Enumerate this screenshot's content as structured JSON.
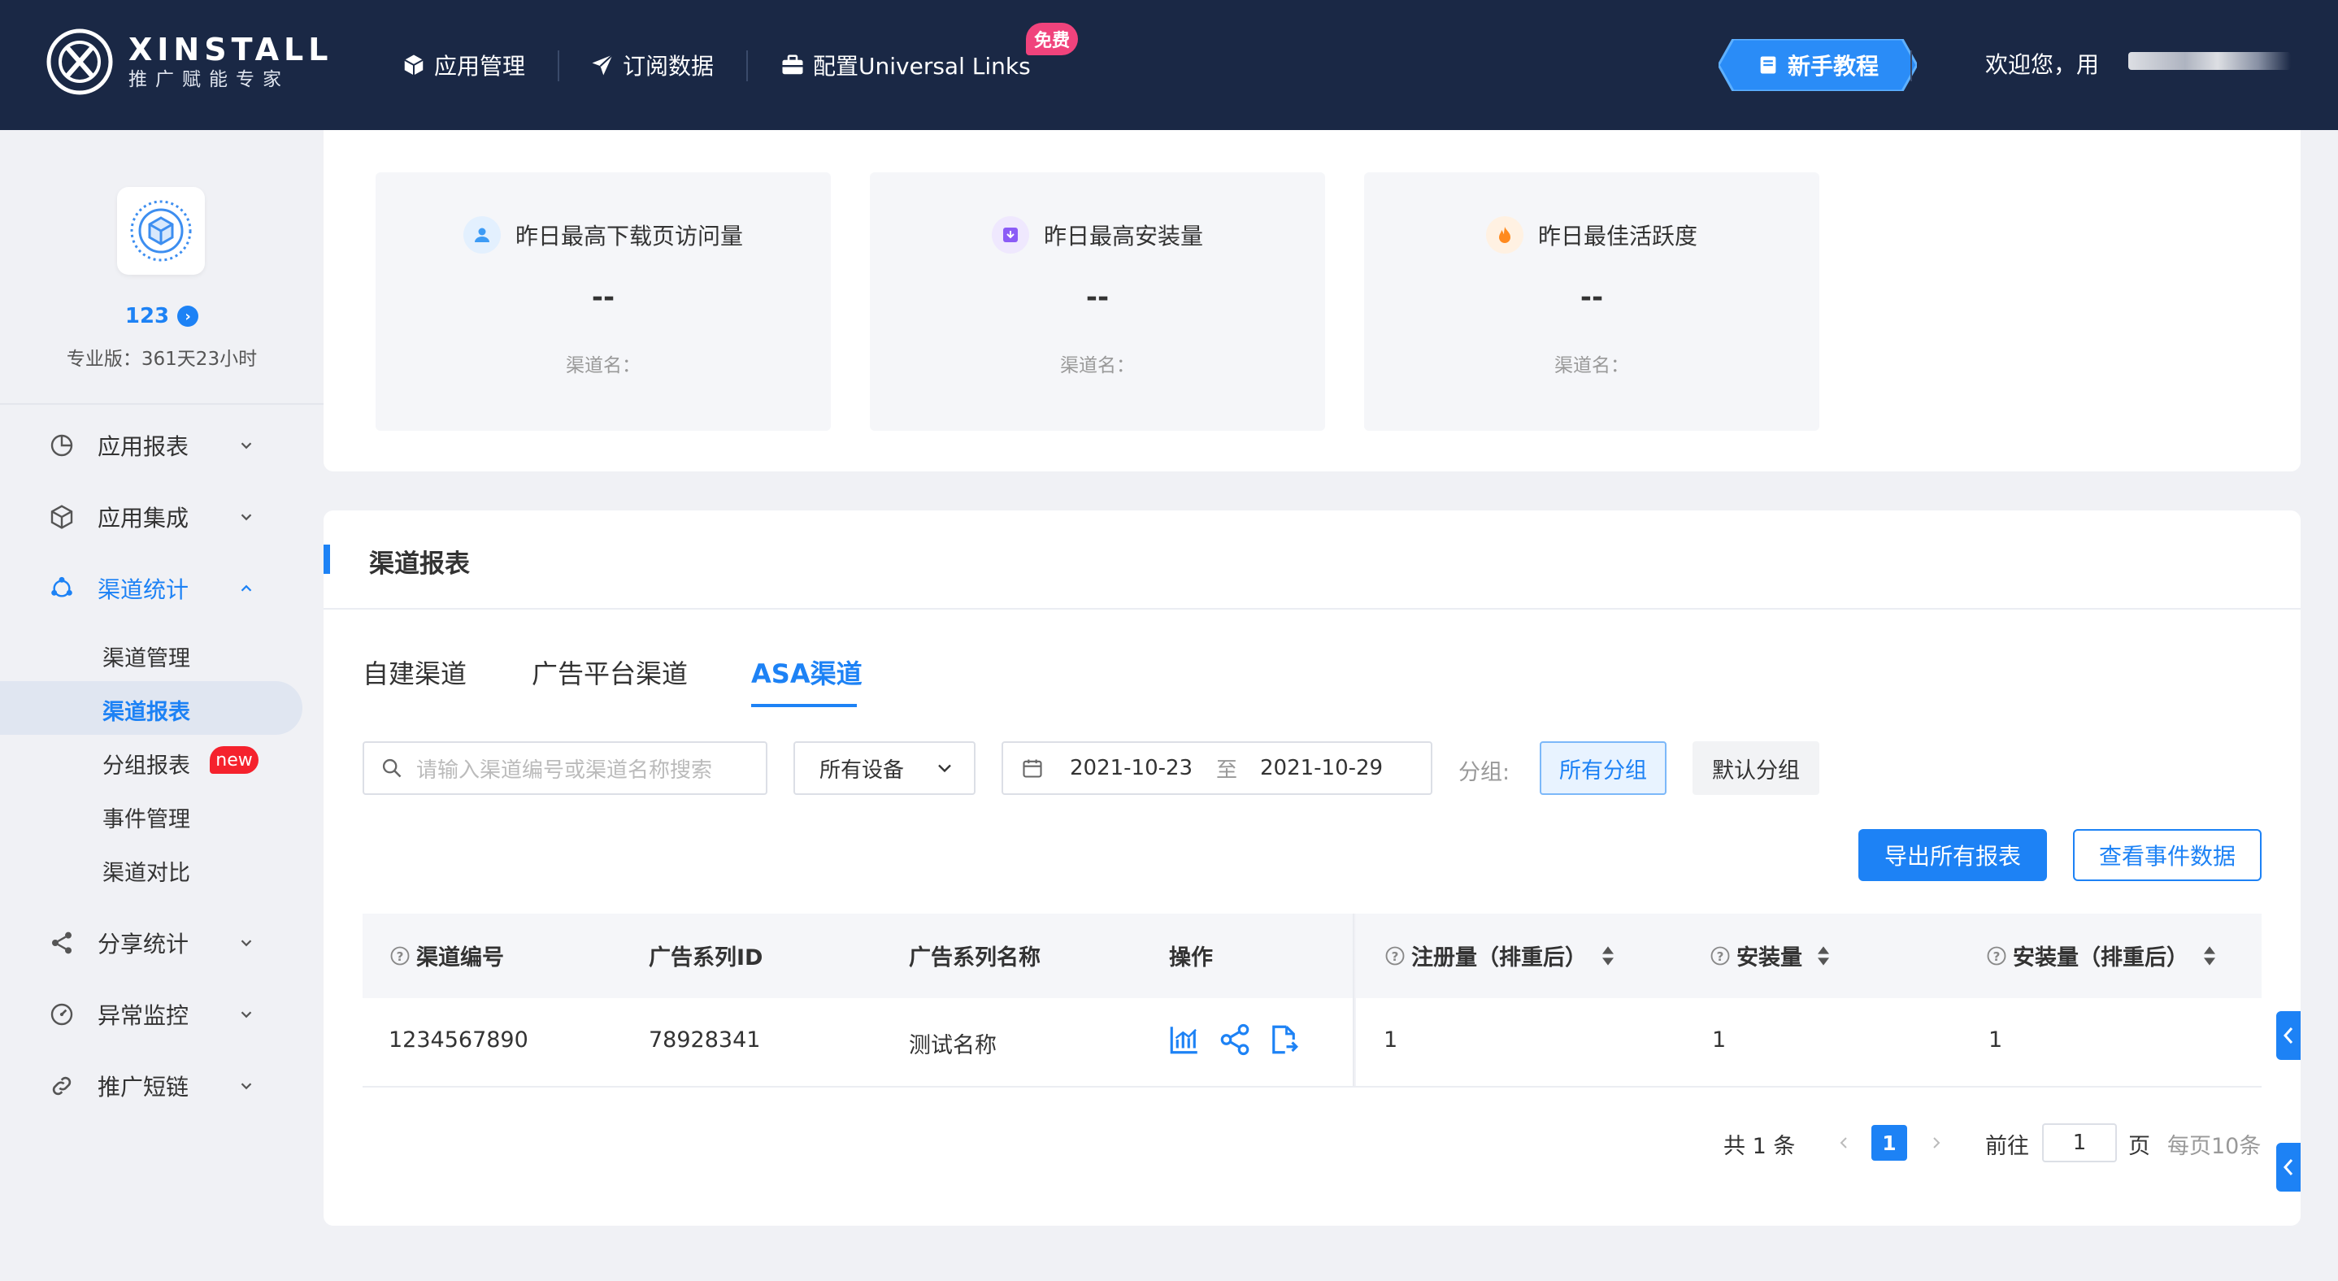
{
  "brand": {
    "name": "XINSTALL",
    "tagline": "推广赋能专家"
  },
  "nav": {
    "items": [
      {
        "label": "应用管理",
        "icon": "cube-icon"
      },
      {
        "label": "订阅数据",
        "icon": "paper-plane-icon"
      },
      {
        "label": "配置Universal Links",
        "icon": "briefcase-icon"
      }
    ],
    "free_badge": "免费",
    "tutorial_label": "新手教程",
    "welcome": "欢迎您，用"
  },
  "sidebar": {
    "app_name": "123",
    "plan": "专业版：361天23小时",
    "menu": [
      {
        "label": "应用报表",
        "icon": "pie-chart-icon"
      },
      {
        "label": "应用集成",
        "icon": "box-icon"
      },
      {
        "label": "渠道统计",
        "icon": "channel-icon",
        "expanded": true
      },
      {
        "label": "分享统计",
        "icon": "share-icon"
      },
      {
        "label": "异常监控",
        "icon": "gauge-icon"
      },
      {
        "label": "推广短链",
        "icon": "link-icon"
      }
    ],
    "sub_items": [
      "渠道管理",
      "渠道报表",
      "分组报表",
      "事件管理",
      "渠道对比"
    ],
    "active_sub": "渠道报表",
    "new_badge": "new"
  },
  "stats": [
    {
      "title": "昨日最高下载页访问量",
      "value": "--",
      "channel": "渠道名：",
      "icon": "user-icon",
      "color": "#3d9bf5"
    },
    {
      "title": "昨日最高安装量",
      "value": "--",
      "channel": "渠道名：",
      "icon": "install-icon",
      "color": "#8b5cf6"
    },
    {
      "title": "昨日最佳活跃度",
      "value": "--",
      "channel": "渠道名：",
      "icon": "fire-icon",
      "color": "#ff8a1f"
    }
  ],
  "report": {
    "title": "渠道报表",
    "tabs": [
      "自建渠道",
      "广告平台渠道",
      "ASA渠道"
    ],
    "active_tab": "ASA渠道",
    "filters": {
      "search_placeholder": "请输入渠道编号或渠道名称搜索",
      "device": "所有设备",
      "date_start": "2021-10-23",
      "date_sep": "至",
      "date_end": "2021-10-29",
      "group_label": "分组:",
      "group_options": [
        "所有分组",
        "默认分组"
      ],
      "group_selected": "所有分组"
    },
    "buttons": {
      "export": "导出所有报表",
      "events": "查看事件数据"
    },
    "columns": [
      "渠道编号",
      "广告系列ID",
      "广告系列名称",
      "操作",
      "注册量（排重后）",
      "安装量",
      "安装量（排重后）"
    ],
    "rows": [
      {
        "channel_id": "1234567890",
        "campaign_id": "78928341",
        "campaign_name": "测试名称",
        "registrations": "1",
        "installs": "1",
        "installs_dedup": "1"
      }
    ],
    "pagination": {
      "total": "共 1 条",
      "page": "1",
      "goto": "前往",
      "goto_value": "1",
      "page_unit": "页",
      "per_page": "每页10条"
    }
  },
  "colors": {
    "nav_bg": "#1a2845",
    "accent": "#1d82f5",
    "page_bg": "#f0f1f5"
  }
}
